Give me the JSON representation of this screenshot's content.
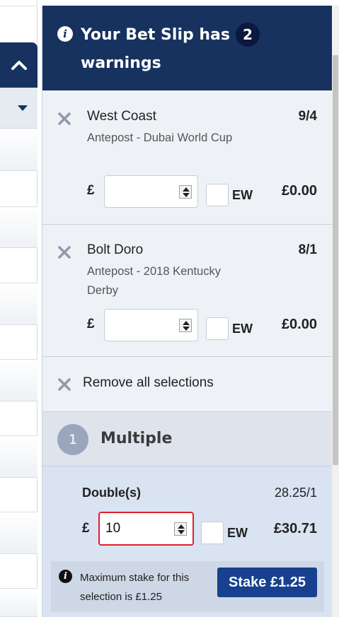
{
  "colors": {
    "header_bg": "#17325f",
    "accent_button": "#17408e",
    "error_border": "#e0202a",
    "panel_bg": "#eef2f7",
    "multiple_bg": "#d9e3f1"
  },
  "left_page": {
    "collapse_icon": "chevron-up-icon",
    "dropdown_icon": "caret-down-icon"
  },
  "header": {
    "info_icon": "info-icon",
    "info_glyph": "i",
    "title_part1": "Your Bet Slip has",
    "warning_count": "2",
    "title_part2": "warnings"
  },
  "selections": [
    {
      "name": "West Coast",
      "odds": "9/4",
      "market": "Antepost - Dubai World Cup",
      "currency": "£",
      "stake": "",
      "ew_label": "EW",
      "returns": "£0.00"
    },
    {
      "name": "Bolt Doro",
      "odds": "8/1",
      "market": "Antepost - 2018 Kentucky Derby",
      "currency": "£",
      "stake": "",
      "ew_label": "EW",
      "returns": "£0.00"
    }
  ],
  "remove_all": {
    "label": "Remove all selections",
    "icon": "close-icon"
  },
  "multiple": {
    "count": "1",
    "title": "Multiple",
    "bet_name": "Double(s)",
    "odds": "28.25/1",
    "currency": "£",
    "stake": "10",
    "ew_label": "EW",
    "returns": "£30.71",
    "warning": {
      "info_glyph": "i",
      "message": "Maximum stake for this selection is £1.25",
      "button_label": "Stake £1.25"
    }
  }
}
